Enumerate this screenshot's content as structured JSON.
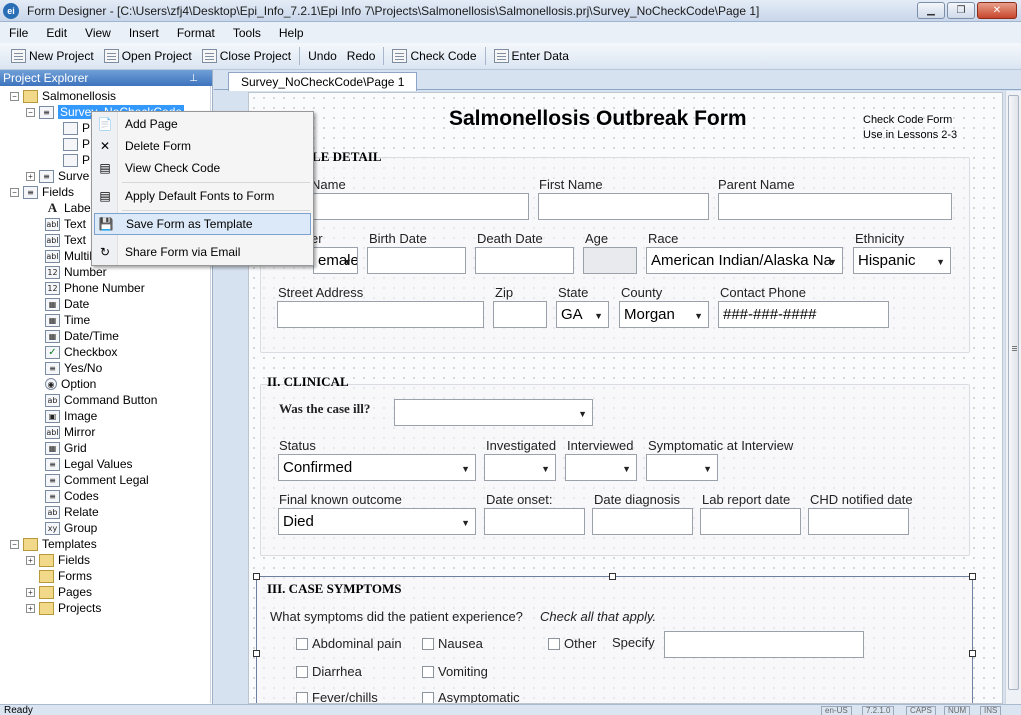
{
  "window": {
    "app_icon": "ei",
    "title": "Form Designer - [C:\\Users\\zfj4\\Desktop\\Epi_Info_7.2.1\\Epi Info 7\\Projects\\Salmonellosis\\Salmonellosis.prj\\Survey_NoCheckCode\\Page 1]",
    "controls": [
      "minimize",
      "restore",
      "close"
    ]
  },
  "menu": [
    "File",
    "Edit",
    "View",
    "Insert",
    "Format",
    "Tools",
    "Help"
  ],
  "toolbar": {
    "new_project": "New Project",
    "open_project": "Open Project",
    "close_project": "Close Project",
    "undo": "Undo",
    "redo": "Redo",
    "check_code": "Check Code",
    "enter_data": "Enter Data"
  },
  "explorer": {
    "title": "Project Explorer",
    "pin_icon": "pin-icon",
    "project": "Salmonellosis",
    "selected_form": "Survey_NoCheckCode",
    "page_items": [
      "P",
      "P",
      "P"
    ],
    "second_form": "Surve",
    "fields_root": "Fields",
    "fields": [
      {
        "label": "Label",
        "icon": "A"
      },
      {
        "label": "Text",
        "icon": "abl"
      },
      {
        "label": "Text",
        "icon": "abl"
      },
      {
        "label": "Multili",
        "icon": "abl"
      },
      {
        "label": "Number",
        "icon": "12"
      },
      {
        "label": "Phone Number",
        "icon": "12"
      },
      {
        "label": "Date",
        "icon": "▦"
      },
      {
        "label": "Time",
        "icon": "▦"
      },
      {
        "label": "Date/Time",
        "icon": "▦"
      },
      {
        "label": "Checkbox",
        "icon": "✓"
      },
      {
        "label": "Yes/No",
        "icon": "≡"
      },
      {
        "label": "Option",
        "icon": "◉"
      },
      {
        "label": "Command Button",
        "icon": "ab"
      },
      {
        "label": "Image",
        "icon": "▣"
      },
      {
        "label": "Mirror",
        "icon": "abl"
      },
      {
        "label": "Grid",
        "icon": "▦"
      },
      {
        "label": "Legal Values",
        "icon": "≡"
      },
      {
        "label": "Comment Legal",
        "icon": "≡"
      },
      {
        "label": "Codes",
        "icon": "≡"
      },
      {
        "label": "Relate",
        "icon": "ab"
      },
      {
        "label": "Group",
        "icon": "xy"
      }
    ],
    "templates_root": "Templates",
    "templates": [
      "Fields",
      "Forms",
      "Pages",
      "Projects"
    ]
  },
  "context_menu": [
    {
      "label": "Add Page",
      "icon": "add-page-icon"
    },
    {
      "label": "Delete Form",
      "icon": "delete-icon"
    },
    {
      "label": "View Check Code",
      "icon": "check-code-icon"
    },
    {
      "label": "Apply Default Fonts to Form",
      "icon": "fonts-icon"
    },
    {
      "label": "Save Form as Template",
      "icon": "save-icon"
    },
    {
      "label": "Share Form via Email",
      "icon": "share-icon"
    }
  ],
  "tab": "Survey_NoCheckCode\\Page 1",
  "form": {
    "title": "Salmonellosis Outbreak Form",
    "check_note_line1": "Check Code Form",
    "check_note_line2": "Use in Lessons 2-3",
    "section1": "ILE DETAIL",
    "last_name": "Name",
    "first_name": "First Name",
    "parent_name": "Parent Name",
    "gender_label": "er",
    "gender_value": "emale",
    "birth_date": "Birth Date",
    "death_date": "Death Date",
    "age": "Age",
    "race": "Race",
    "race_value": "American Indian/Alaska Na",
    "ethnicity": "Ethnicity",
    "ethnicity_value": "Hispanic",
    "street": "Street Address",
    "zip": "Zip",
    "state": "State",
    "state_value": "GA",
    "county": "County",
    "county_value": "Morgan",
    "contact_phone": "Contact Phone",
    "phone_mask": "###-###-####",
    "section2": "II. CLINICAL",
    "was_ill": "Was the case ill?",
    "status": "Status",
    "status_value": "Confirmed",
    "investigated": "Investigated",
    "interviewed": "Interviewed",
    "symptomatic": "Symptomatic at Interview",
    "outcome": "Final known outcome",
    "outcome_value": "Died",
    "date_onset": "Date onset:",
    "date_diagnosis": "Date diagnosis",
    "lab_report": "Lab report date",
    "chd_notified": "CHD notified date",
    "section3": "III. CASE SYMPTOMS",
    "symptoms_question": "What symptoms did the patient experience?",
    "check_all": "Check all that apply.",
    "symptoms": [
      "Abdominal pain",
      "Nausea",
      "Other",
      "Diarrhea",
      "Vomiting",
      "Fever/chills",
      "Asymptomatic"
    ],
    "specify": "Specify"
  },
  "status_bar": {
    "text": "Ready",
    "panels": [
      "en-US",
      "7.2.1.0",
      "CAPS",
      "NUM",
      "INS"
    ]
  }
}
